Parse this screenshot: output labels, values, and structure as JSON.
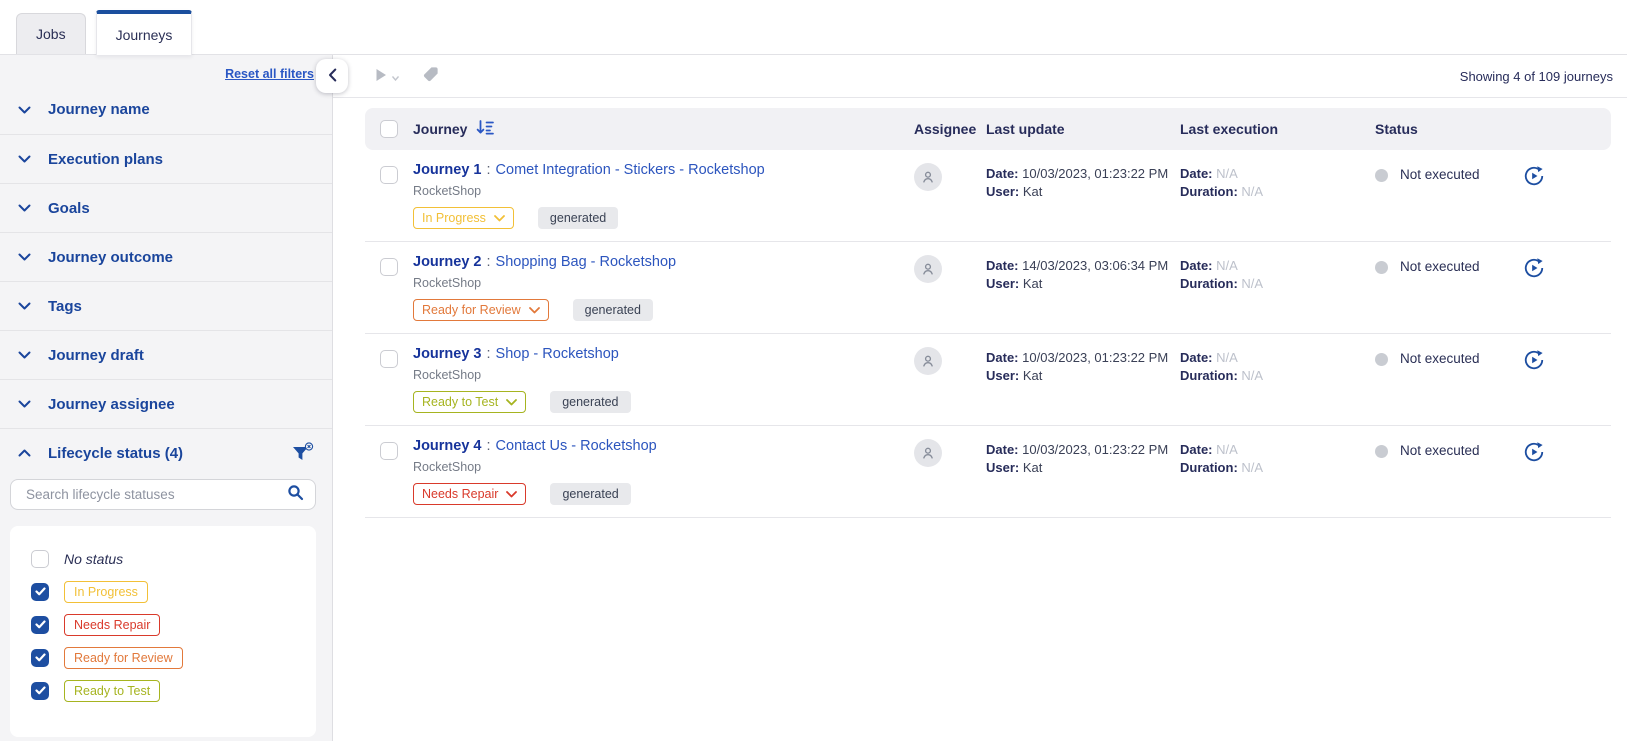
{
  "colors": {
    "accent_blue": "#1D4EA1",
    "tab_active_bar": "#1B4F9E",
    "link_blue": "#2A57C4",
    "section_title_blue": "#1A459C",
    "yellow_in_progress": "#F2C037",
    "red_needs_repair": "#D93A2B",
    "orange_ready_for_review": "#E2793B",
    "olive_ready_to_test": "#A6B420",
    "disabled_icon_gray": "#B7BBC3",
    "status_dot_gray": "#C9CCD2"
  },
  "icons": {
    "collapse": "chevron-left-icon",
    "section_collapsed": "chevron-down-icon",
    "section_expanded": "chevron-up-icon",
    "lifecycle_filter": "funnel-clear-icon",
    "search": "search-icon",
    "sort": "sort-descending-icon",
    "run_disabled": "play-icon",
    "tag_disabled": "tag-icon",
    "assignee": "person-icon",
    "run_row": "run-journey-icon"
  },
  "tabs": [
    {
      "label": "Jobs",
      "active": false
    },
    {
      "label": "Journeys",
      "active": true
    }
  ],
  "sidebar": {
    "reset_filters_label": "Reset all filters",
    "sections": [
      {
        "label": "Journey name",
        "expanded": false
      },
      {
        "label": "Execution plans",
        "expanded": false
      },
      {
        "label": "Goals",
        "expanded": false
      },
      {
        "label": "Journey outcome",
        "expanded": false
      },
      {
        "label": "Tags",
        "expanded": false
      },
      {
        "label": "Journey draft",
        "expanded": false
      },
      {
        "label": "Journey assignee",
        "expanded": false
      },
      {
        "label": "Lifecycle status (4)",
        "expanded": true
      }
    ],
    "lifecycle_search": {
      "placeholder": "Search lifecycle statuses"
    },
    "status_options": [
      {
        "label": "No status",
        "checked": false,
        "type": "plain"
      },
      {
        "label": "In Progress",
        "checked": true,
        "color": "#F2C037"
      },
      {
        "label": "Needs Repair",
        "checked": true,
        "color": "#D93A2B"
      },
      {
        "label": "Ready for Review",
        "checked": true,
        "color": "#E2793B"
      },
      {
        "label": "Ready to Test",
        "checked": true,
        "color": "#A6B420"
      }
    ]
  },
  "toolbar": {
    "showing_text": "Showing 4 of 109 journeys"
  },
  "table": {
    "headers": {
      "journey": "Journey",
      "assignee": "Assignee",
      "last_update": "Last update",
      "last_execution": "Last execution",
      "status": "Status"
    },
    "rows": [
      {
        "name": "Journey 1",
        "sep": ":",
        "title": "Comet Integration - Stickers - Rocketshop",
        "subtitle": "RocketShop",
        "lifecycle": {
          "label": "In Progress",
          "color": "#F2C037"
        },
        "tag": "generated",
        "update": {
          "date_label": "Date:",
          "date": "10/03/2023, 01:23:22 PM",
          "user_label": "User:",
          "user": "Kat"
        },
        "execution": {
          "date_label": "Date:",
          "date": "N/A",
          "duration_label": "Duration:",
          "duration": "N/A"
        },
        "status": "Not executed"
      },
      {
        "name": "Journey 2",
        "sep": ":",
        "title": "Shopping Bag - Rocketshop",
        "subtitle": "RocketShop",
        "lifecycle": {
          "label": "Ready for Review",
          "color": "#E2793B"
        },
        "tag": "generated",
        "update": {
          "date_label": "Date:",
          "date": "14/03/2023, 03:06:34 PM",
          "user_label": "User:",
          "user": "Kat"
        },
        "execution": {
          "date_label": "Date:",
          "date": "N/A",
          "duration_label": "Duration:",
          "duration": "N/A"
        },
        "status": "Not executed"
      },
      {
        "name": "Journey 3",
        "sep": ":",
        "title": "Shop - Rocketshop",
        "subtitle": "RocketShop",
        "lifecycle": {
          "label": "Ready to Test",
          "color": "#A6B420"
        },
        "tag": "generated",
        "update": {
          "date_label": "Date:",
          "date": "10/03/2023, 01:23:22 PM",
          "user_label": "User:",
          "user": "Kat"
        },
        "execution": {
          "date_label": "Date:",
          "date": "N/A",
          "duration_label": "Duration:",
          "duration": "N/A"
        },
        "status": "Not executed"
      },
      {
        "name": "Journey 4",
        "sep": ":",
        "title": "Contact Us - Rocketshop",
        "subtitle": "RocketShop",
        "lifecycle": {
          "label": "Needs Repair",
          "color": "#D93A2B"
        },
        "tag": "generated",
        "update": {
          "date_label": "Date:",
          "date": "10/03/2023, 01:23:22 PM",
          "user_label": "User:",
          "user": "Kat"
        },
        "execution": {
          "date_label": "Date:",
          "date": "N/A",
          "duration_label": "Duration:",
          "duration": "N/A"
        },
        "status": "Not executed"
      }
    ]
  }
}
